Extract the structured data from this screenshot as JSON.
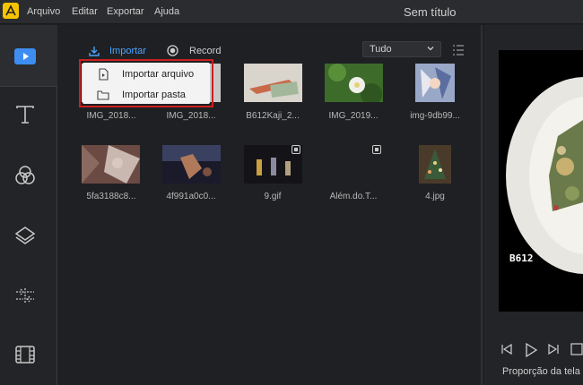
{
  "titlebar": {
    "menus": [
      "Arquivo",
      "Editar",
      "Exportar",
      "Ajuda"
    ],
    "title": "Sem título"
  },
  "media": {
    "tabs": {
      "import_label": "Importar",
      "record_label": "Record"
    },
    "filter": {
      "selected": "Tudo"
    },
    "import_menu": {
      "items": [
        "Importar arquivo",
        "Importar pasta"
      ]
    },
    "items": [
      {
        "label": "IMG_2018...",
        "kind": "image"
      },
      {
        "label": "IMG_2018...",
        "kind": "image"
      },
      {
        "label": "B612Kaji_2...",
        "kind": "image"
      },
      {
        "label": "IMG_2019...",
        "kind": "image"
      },
      {
        "label": "img-9db99...",
        "kind": "image"
      },
      {
        "label": "5fa3188c8...",
        "kind": "image"
      },
      {
        "label": "4f991a0c0...",
        "kind": "image"
      },
      {
        "label": "9.gif",
        "kind": "gif"
      },
      {
        "label": "Além.do.T...",
        "kind": "video"
      },
      {
        "label": "4.jpg",
        "kind": "image"
      }
    ]
  },
  "preview": {
    "watermark": "B612",
    "aspect_label": "Proporção da tela"
  },
  "colors": {
    "accent": "#4aa3ff",
    "brand": "#f5c400",
    "highlight": "#cc1f1f"
  }
}
